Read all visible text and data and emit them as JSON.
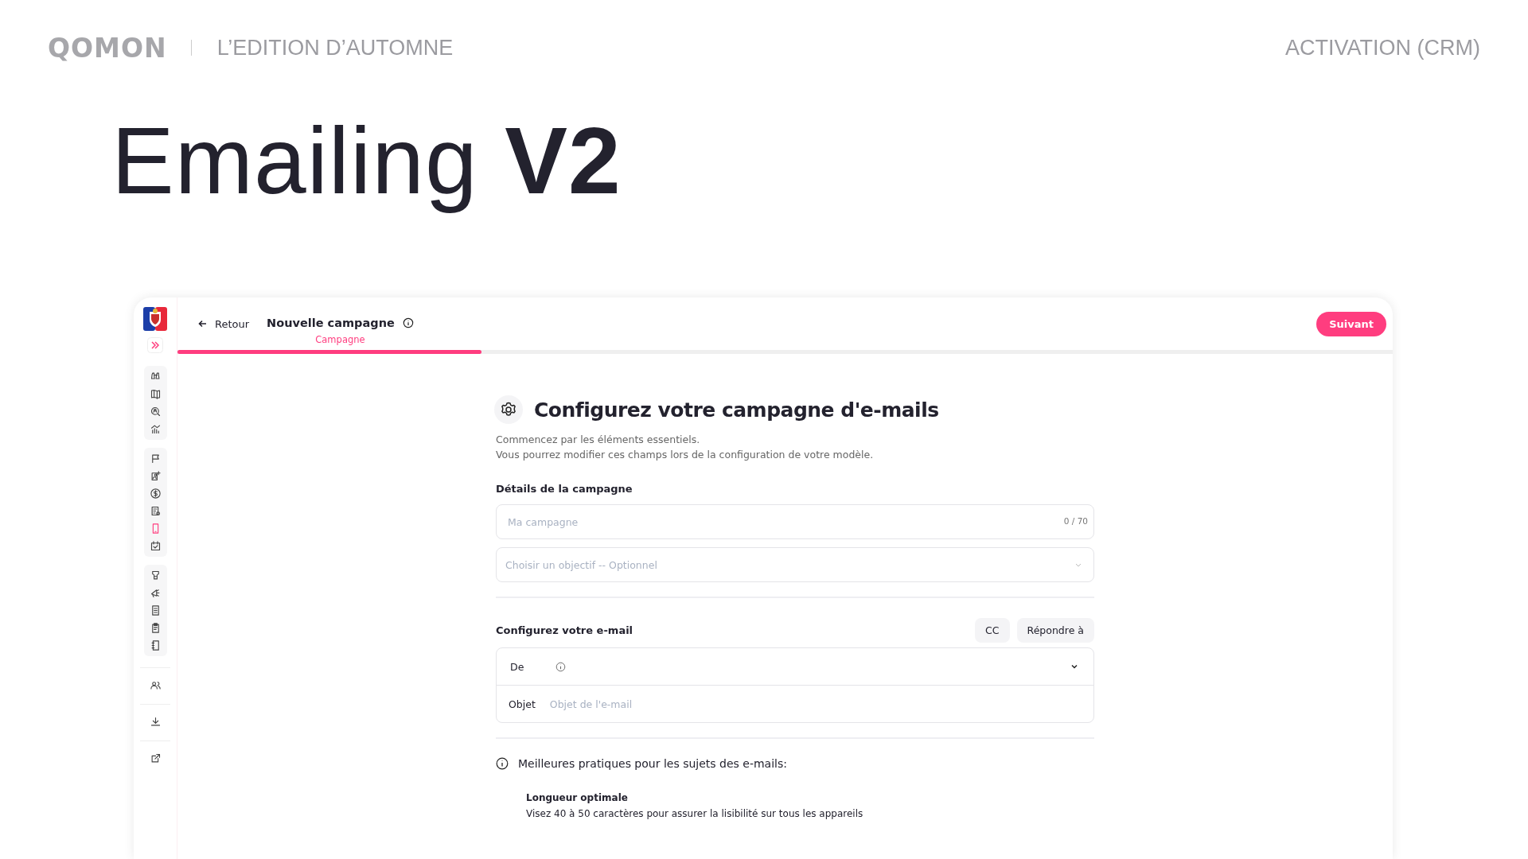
{
  "slide": {
    "logo": "QOMON",
    "edition": "L’EDITION D’AUTOMNE",
    "section": "ACTIVATION (CRM)",
    "title": "Emailing **V2**"
  },
  "app": {
    "sidebar": {
      "groups": [
        {
          "items": [
            {
              "selected": false
            },
            {
              "selected": false
            },
            {
              "selected": false
            },
            {
              "selected": false
            }
          ]
        },
        {
          "items": [
            {
              "selected": false
            },
            {
              "selected": false
            },
            {
              "selected": false
            },
            {
              "selected": false
            },
            {
              "selected": true
            },
            {
              "selected": false
            }
          ]
        },
        {
          "items": [
            {
              "selected": false
            },
            {
              "selected": false
            },
            {
              "selected": false
            },
            {
              "selected": false
            },
            {
              "selected": false
            }
          ]
        }
      ],
      "extra": [
        {
          "selected": false
        },
        {
          "selected": false
        },
        {
          "selected": false
        }
      ]
    },
    "header": {
      "back": "Retour",
      "title": "Nouvelle campagne",
      "step": "Campagne",
      "next": "Suivant",
      "progress": {
        "level": 0.25
      }
    },
    "form": {
      "title": "Configurez votre campagne d'e-mails",
      "intro": [
        "Commencez par les éléments essentiels.",
        "Vous pourrez modifier ces champs lors de la configuration de votre modèle."
      ],
      "details_label": "Détails de la campagne",
      "name_field": {
        "placeholder": "Ma campagne",
        "counter": "0 / 70"
      },
      "objective_select": {
        "placeholder": "Choisir un objectif -- Optionnel"
      },
      "email_label": "Configurez votre e-mail",
      "email_buttons": [
        "CC",
        "Répondre à"
      ],
      "from_label": "De",
      "subject_label": "Objet",
      "subject_field": {
        "placeholder": "Objet de l'e-mail"
      },
      "tips_title": "Meilleures pratiques pour les sujets des e-mails:",
      "tips": [
        {
          "title": "Longueur optimale",
          "text": "Visez 40 à 50 caractères pour assurer la lisibilité sur tous les appareils"
        }
      ]
    }
  }
}
